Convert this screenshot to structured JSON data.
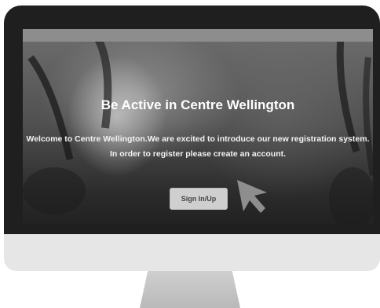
{
  "hero": {
    "headline": "Be Active in Centre Wellington",
    "intro_line1": "Welcome to Centre Wellington.We are excited to introduce our new registration system.",
    "intro_line2": "In order to register please create an account."
  },
  "actions": {
    "sign_in_label": "Sign In/Up"
  },
  "colors": {
    "bezel": "#1f1f1f",
    "chin": "#e6e6e6",
    "button": "#cfcfcf",
    "cursor": "#8e8e8e"
  },
  "icons": {
    "pointer": "arrow-cursor-icon"
  }
}
